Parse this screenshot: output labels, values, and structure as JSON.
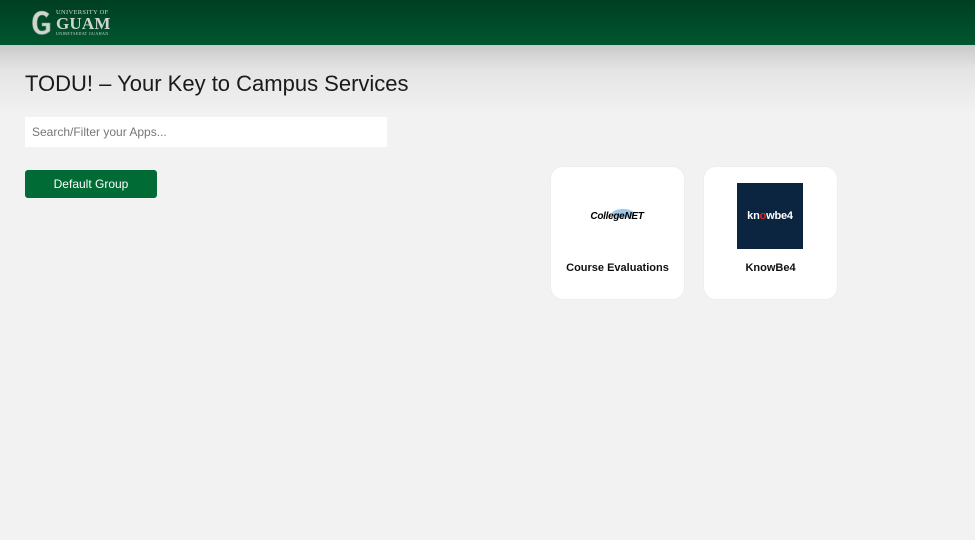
{
  "header": {
    "logo": {
      "top_text": "UNIVERSITY OF",
      "main_text": "GUAM",
      "sub_text": "UNIBETSEDAT GUAHAN",
      "colors": {
        "bar": "#00562f",
        "logo": "#cfd6cf"
      }
    }
  },
  "page": {
    "title": "TODU! – Your Key to Campus Services"
  },
  "search": {
    "placeholder": "Search/Filter your Apps...",
    "value": ""
  },
  "groups": [
    {
      "label": "Default Group",
      "color": "#006b34"
    }
  ],
  "apps": [
    {
      "label": "Course Evaluations",
      "logo_text_1": "College",
      "logo_text_2": "NET",
      "icon": "collegenet-logo"
    },
    {
      "label": "KnowBe4",
      "logo_text_1": "kn",
      "logo_text_2": "o",
      "logo_text_3": "wbe4",
      "icon": "knowbe4-logo"
    }
  ]
}
